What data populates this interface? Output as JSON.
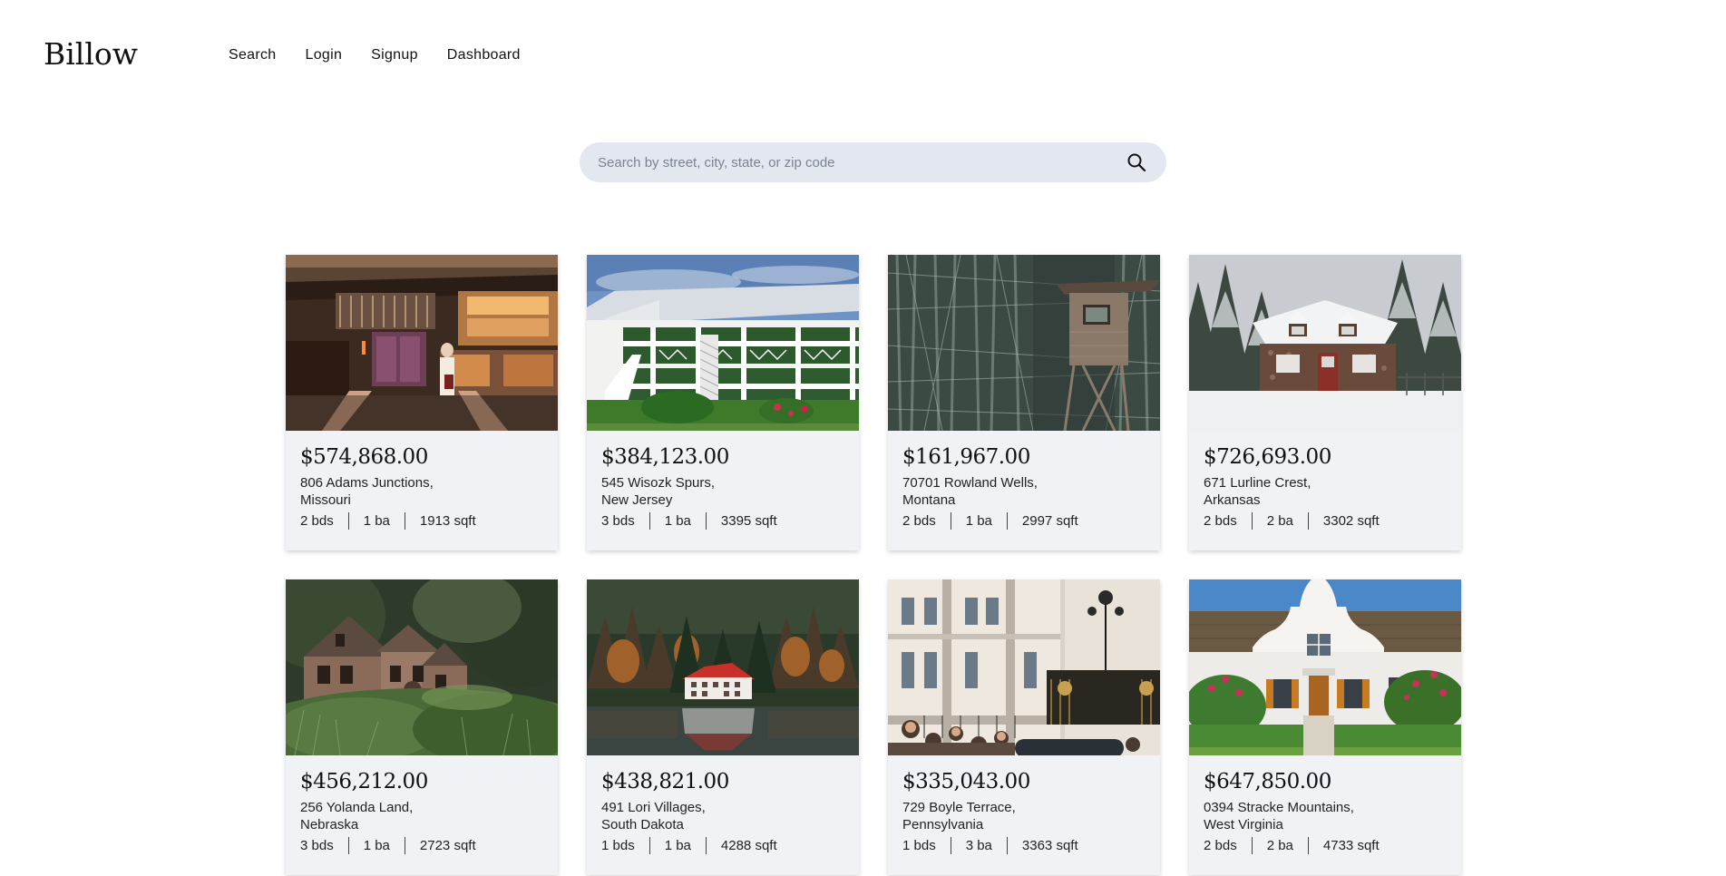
{
  "header": {
    "logo": "Billow",
    "nav": [
      "Search",
      "Login",
      "Signup",
      "Dashboard"
    ]
  },
  "search": {
    "placeholder": "Search by street, city, state, or zip code",
    "icon": "search-icon"
  },
  "listings": [
    {
      "price": "$574,868.00",
      "addr1": "806 Adams Junctions,",
      "addr2": "Missouri",
      "beds": "2 bds",
      "baths": "1 ba",
      "sqft": "1913 sqft",
      "image": "japanese-ryokan-photo"
    },
    {
      "price": "$384,123.00",
      "addr1": "545 Wisozk Spurs,",
      "addr2": "New Jersey",
      "beds": "3 bds",
      "baths": "1 ba",
      "sqft": "3395 sqft",
      "image": "white-colonial-building-photo"
    },
    {
      "price": "$161,967.00",
      "addr1": "70701 Rowland Wells,",
      "addr2": "Montana",
      "beds": "2 bds",
      "baths": "1 ba",
      "sqft": "2997 sqft",
      "image": "forest-hunting-stand-photo"
    },
    {
      "price": "$726,693.00",
      "addr1": "671 Lurline Crest,",
      "addr2": "Arkansas",
      "beds": "2 bds",
      "baths": "2 ba",
      "sqft": "3302 sqft",
      "image": "snowy-cottage-photo"
    },
    {
      "price": "$456,212.00",
      "addr1": "256 Yolanda Land,",
      "addr2": "Nebraska",
      "beds": "3 bds",
      "baths": "1 ba",
      "sqft": "2723 sqft",
      "image": "stone-mill-house-photo"
    },
    {
      "price": "$438,821.00",
      "addr1": "491 Lori Villages,",
      "addr2": "South Dakota",
      "beds": "1 bds",
      "baths": "1 ba",
      "sqft": "4288 sqft",
      "image": "lakeside-lodge-photo"
    },
    {
      "price": "$335,043.00",
      "addr1": "729 Boyle Terrace,",
      "addr2": "Pennsylvania",
      "beds": "1 bds",
      "baths": "3 ba",
      "sqft": "3363 sqft",
      "image": "palace-gates-photo"
    },
    {
      "price": "$647,850.00",
      "addr1": "0394 Stracke Mountains,",
      "addr2": "West Virginia",
      "beds": "2 bds",
      "baths": "2 ba",
      "sqft": "4733 sqft",
      "image": "cape-dutch-house-photo"
    }
  ]
}
